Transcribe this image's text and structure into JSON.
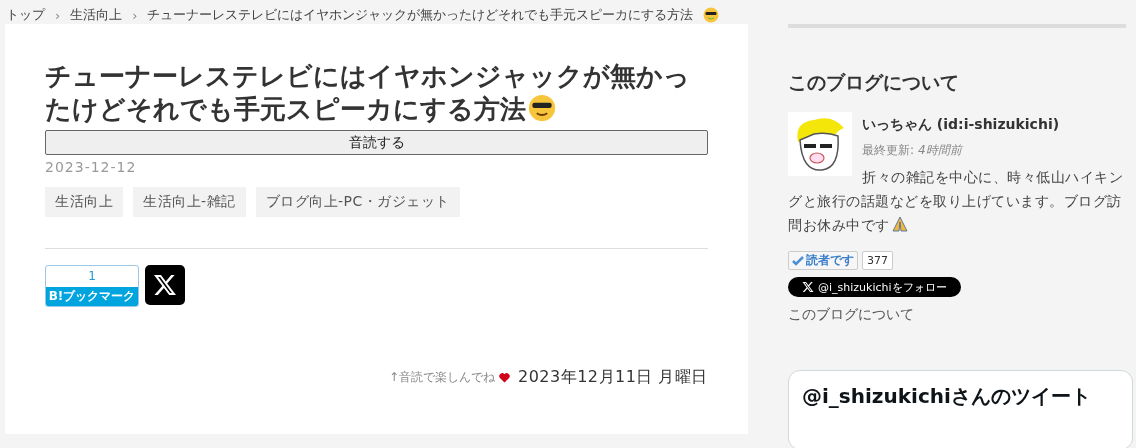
{
  "breadcrumb": [
    {
      "label": "トップ"
    },
    {
      "label": "生活向上"
    },
    {
      "label": "チューナーレステレビにはイヤホンジャックが無かったけどそれでも手元スピーカにする方法"
    }
  ],
  "breadcrumb_separator": "›",
  "article": {
    "title_lines": [
      "チューナーレステレビにはイヤホンジャックが無かっ",
      "たけどそれでも手元スピーカにする方法"
    ],
    "read_button": "音読する",
    "date": "2023-12-12",
    "tags": [
      "生活向上",
      "生活向上-雑記",
      "ブログ向上-PC・ガジェット"
    ],
    "bookmark": {
      "count": "1",
      "label": "B!ブックマーク"
    },
    "note": "↑音読で楽しんでね",
    "posted": "2023年12月11日 月曜日"
  },
  "sidebar": {
    "heading": "このブログについて",
    "name": "いっちゃん (id:i-shizukichi)",
    "updated_label": "最終更新:",
    "updated_value": "4時間前",
    "description": "折々の雑記を中心に、時々低山ハイキングと旅行の話題などを取り上げています。ブログ訪問お休み中です",
    "reader_button": "読者です",
    "reader_count": "377",
    "follow_button": "@i_shizukichiをフォロー",
    "about_link": "このブログについて",
    "tweets_title": "@i_shizukichiさんのツイート"
  }
}
